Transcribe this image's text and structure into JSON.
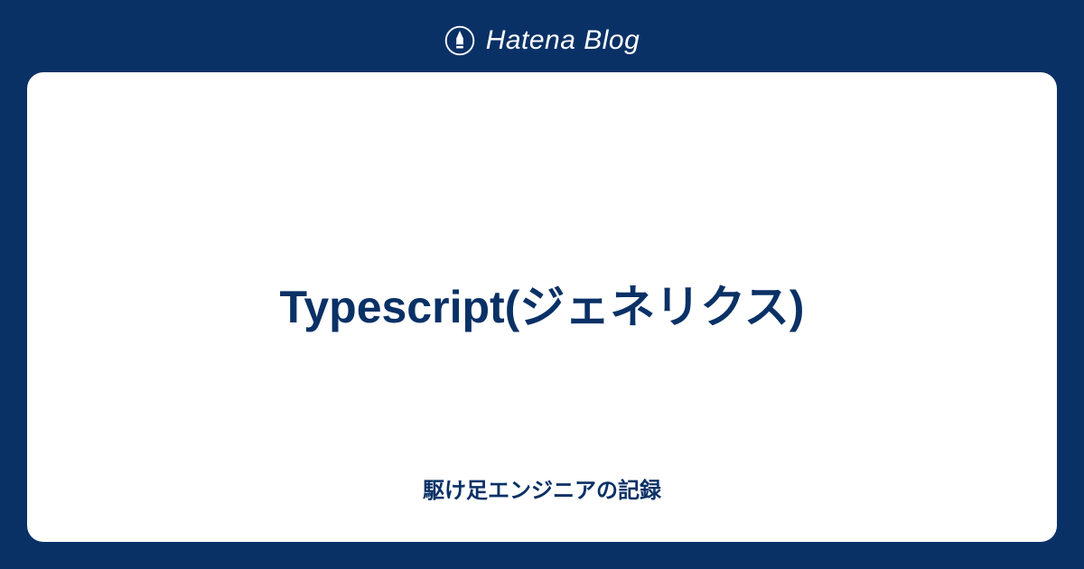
{
  "header": {
    "brand_name": "Hatena Blog",
    "icon_name": "hatena-pen-icon"
  },
  "card": {
    "title": "Typescript(ジェネリクス)",
    "subtitle": "駆け足エンジニアの記録"
  },
  "colors": {
    "background": "#0a3166",
    "card_background": "#ffffff",
    "text_primary": "#0a3166",
    "text_light": "#ffffff"
  }
}
